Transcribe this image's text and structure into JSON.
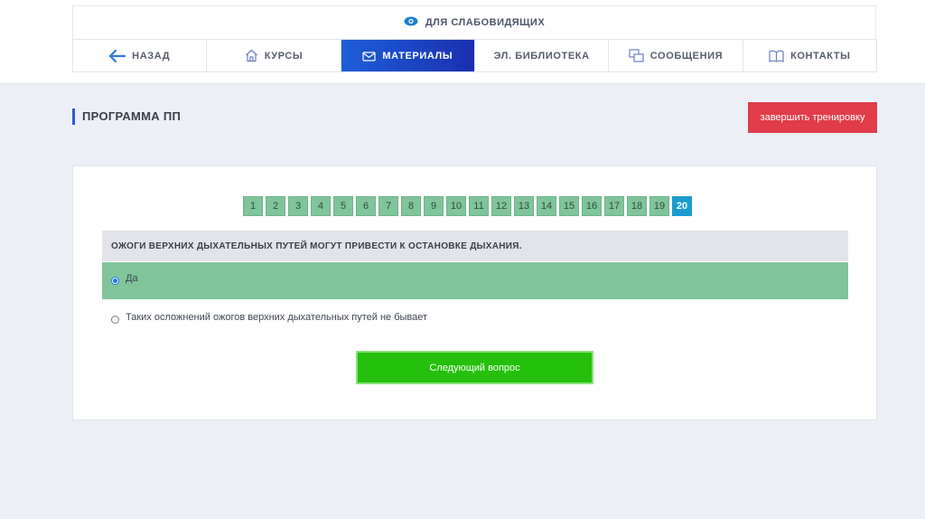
{
  "accessibility": {
    "label": "ДЛЯ СЛАБОВИДЯЩИХ"
  },
  "nav": {
    "items": [
      {
        "label": "НАЗАД",
        "icon": "arrow-left-icon"
      },
      {
        "label": "КУРСЫ",
        "icon": "home-icon"
      },
      {
        "label": "МАТЕРИАЛЫ",
        "icon": "envelope-icon",
        "active": true
      },
      {
        "label": "ЭЛ. БИБЛИОТЕКА",
        "icon": ""
      },
      {
        "label": "СООБЩЕНИЯ",
        "icon": "chat-icon"
      },
      {
        "label": "КОНТАКТЫ",
        "icon": "book-icon"
      }
    ]
  },
  "page": {
    "title": "ПРОГРАММА ПП"
  },
  "finish_button": {
    "label": "завершить тренировку"
  },
  "question_numbers": [
    "1",
    "2",
    "3",
    "4",
    "5",
    "6",
    "7",
    "8",
    "9",
    "10",
    "11",
    "12",
    "13",
    "14",
    "15",
    "16",
    "17",
    "18",
    "19",
    "20"
  ],
  "current_question": "20",
  "question": {
    "text": "ОЖОГИ ВЕРХНИХ ДЫХАТЕЛЬНЫХ ПУТЕЙ МОГУТ ПРИВЕСТИ К ОСТАНОВКЕ ДЫХАНИЯ."
  },
  "answers": [
    {
      "text": "Да",
      "selected": true
    },
    {
      "text": "Таких осложнений ожогов верхних дыхательных путей не бывает",
      "selected": false
    }
  ],
  "next_button": {
    "label": "Следующий вопрос"
  },
  "colors": {
    "accent_blue": "#1d5fd8",
    "danger_red": "#e03c4a",
    "answered_green": "#80c49a",
    "current_blue": "#1a9ccf",
    "next_green": "#25c00c"
  }
}
